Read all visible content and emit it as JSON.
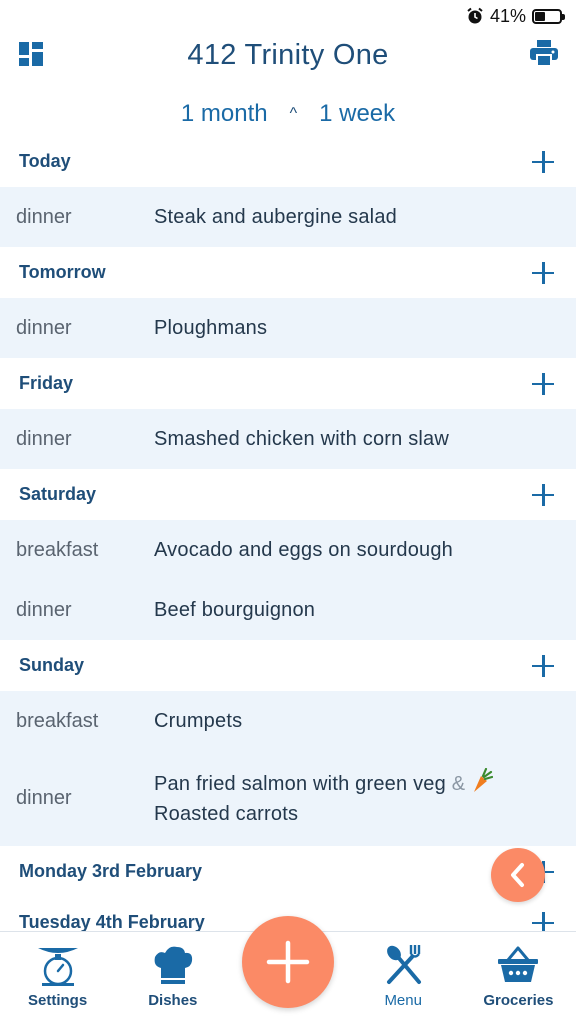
{
  "status_bar": {
    "battery": "41%",
    "battery_level": 0.41
  },
  "header": {
    "title": "412 Trinity One"
  },
  "range": {
    "left": "1 month",
    "caret": "^",
    "right": "1 week"
  },
  "days": [
    {
      "label": "Today",
      "meals": [
        {
          "type": "dinner",
          "name": "Steak and aubergine salad"
        }
      ]
    },
    {
      "label": "Tomorrow",
      "meals": [
        {
          "type": "dinner",
          "name": "Ploughmans"
        }
      ]
    },
    {
      "label": "Friday",
      "meals": [
        {
          "type": "dinner",
          "name": "Smashed chicken with corn slaw"
        }
      ]
    },
    {
      "label": "Saturday",
      "meals": [
        {
          "type": "breakfast",
          "name": "Avocado and eggs on sourdough"
        },
        {
          "type": "dinner",
          "name": "Beef bourguignon"
        }
      ]
    },
    {
      "label": "Sunday",
      "meals": [
        {
          "type": "breakfast",
          "name": "Crumpets"
        },
        {
          "type": "dinner",
          "name": "Pan fried salmon with green veg",
          "amp": "&",
          "side_icon": "carrot-icon",
          "side_name": "Roasted carrots"
        }
      ]
    },
    {
      "label": "Monday 3rd February",
      "meals": []
    },
    {
      "label": "Tuesday 4th February",
      "meals": []
    }
  ],
  "nav": {
    "settings": "Settings",
    "dishes": "Dishes",
    "menu": "Menu",
    "groceries": "Groceries"
  },
  "colors": {
    "accent": "#1a6aa6",
    "title": "#1f4e79",
    "fab": "#fb8a66",
    "row_bg": "#edf4fb"
  }
}
